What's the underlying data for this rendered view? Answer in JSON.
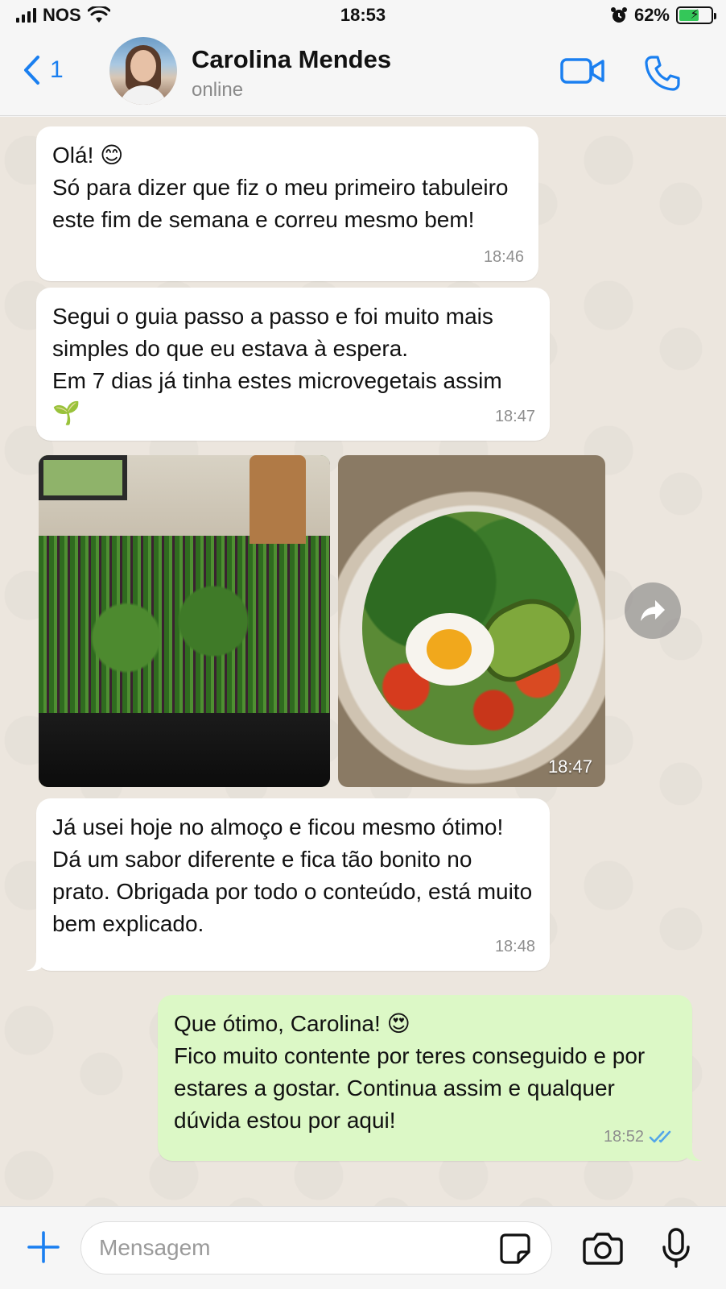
{
  "status_bar": {
    "carrier": "NOS",
    "time": "18:53",
    "battery": "62%",
    "battery_level": 0.62
  },
  "header": {
    "back_count": "1",
    "contact_name": "Carolina Mendes",
    "contact_status": "online"
  },
  "messages": [
    {
      "direction": "in",
      "text": "Olá! 😊\nSó para dizer que fiz o meu primeiro tabuleiro este fim de semana e correu mesmo bem!",
      "time": "18:46"
    },
    {
      "direction": "in",
      "text": "Segui o guia passo a passo e foi muito mais simples do que eu estava à espera.\nEm 7 dias já tinha estes microvegetais assim 🌱",
      "time": "18:47"
    },
    {
      "direction": "in",
      "type": "photos",
      "time": "18:47",
      "photos": [
        "microgreens-tray-photo",
        "salad-bowl-photo"
      ]
    },
    {
      "direction": "in",
      "text": "Já usei hoje no almoço e ficou mesmo ótimo! Dá um sabor diferente e fica tão bonito no prato. Obrigada por todo o conteúdo, está muito bem explicado.",
      "time": "18:48"
    },
    {
      "direction": "out",
      "text": "Que ótimo, Carolina! 😍\nFico muito contente por teres conseguido e por estares a gostar. Continua assim e qualquer dúvida estou por aqui!",
      "time": "18:52",
      "status": "read"
    }
  ],
  "composer": {
    "placeholder": "Mensagem"
  },
  "colors": {
    "accent": "#1a7ff0",
    "outgoing_bubble": "#dcf8c6",
    "incoming_bubble": "#ffffff",
    "chat_background": "#ece6de"
  }
}
